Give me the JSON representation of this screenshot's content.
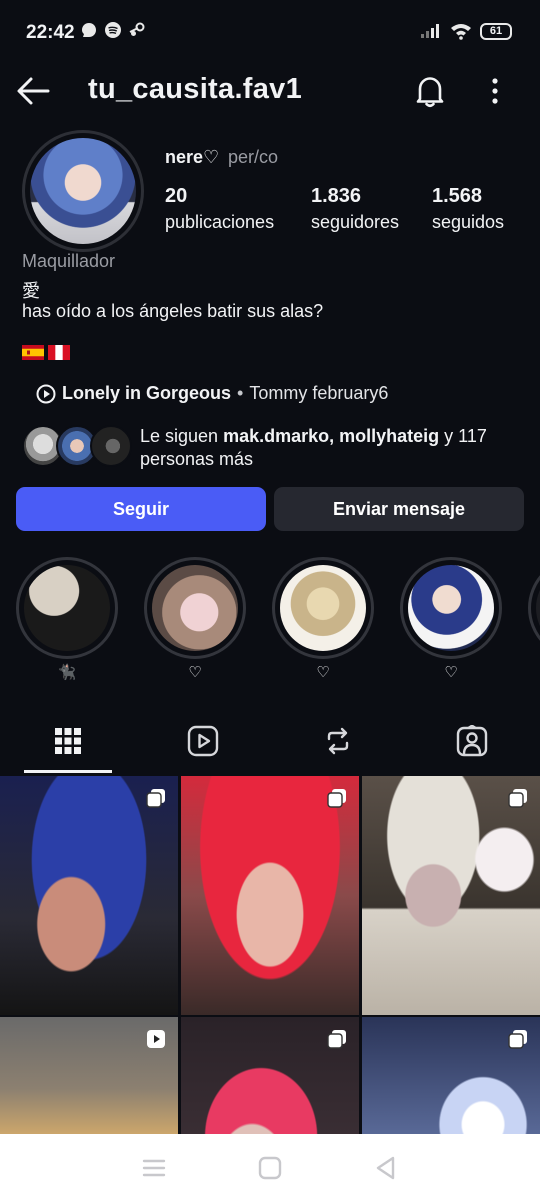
{
  "status": {
    "time": "22:42",
    "battery": "61"
  },
  "header": {
    "username": "tu_causita.fav1"
  },
  "profile": {
    "display_name": "nere♡",
    "pronouns": "per/co",
    "stats": [
      {
        "value": "20",
        "label": "publicaciones"
      },
      {
        "value": "1.836",
        "label": "seguidores"
      },
      {
        "value": "1.568",
        "label": "seguidos"
      }
    ],
    "category": "Maquillador",
    "bio_line1": "愛",
    "bio_line2": "has oído a los ángeles batir sus alas?",
    "music": {
      "title": "Lonely in Gorgeous",
      "separator": "•",
      "artist": "Tommy february6"
    },
    "followed_by": {
      "prefix": "Le siguen ",
      "names": "mak.dmarko, mollyhateig",
      "suffix": " y 117 personas más"
    }
  },
  "buttons": {
    "follow": "Seguir",
    "message": "Enviar mensaje"
  },
  "highlights": [
    {
      "label": "🐈‍⬛"
    },
    {
      "label": "♡"
    },
    {
      "label": "♡"
    },
    {
      "label": "♡"
    }
  ],
  "tabs": [
    "grid-icon",
    "reels-icon",
    "reposts-icon",
    "tagged-icon"
  ],
  "colors": {
    "accent": "#4a5cf6",
    "background": "#0b0d13",
    "secondary_button": "#262830"
  }
}
